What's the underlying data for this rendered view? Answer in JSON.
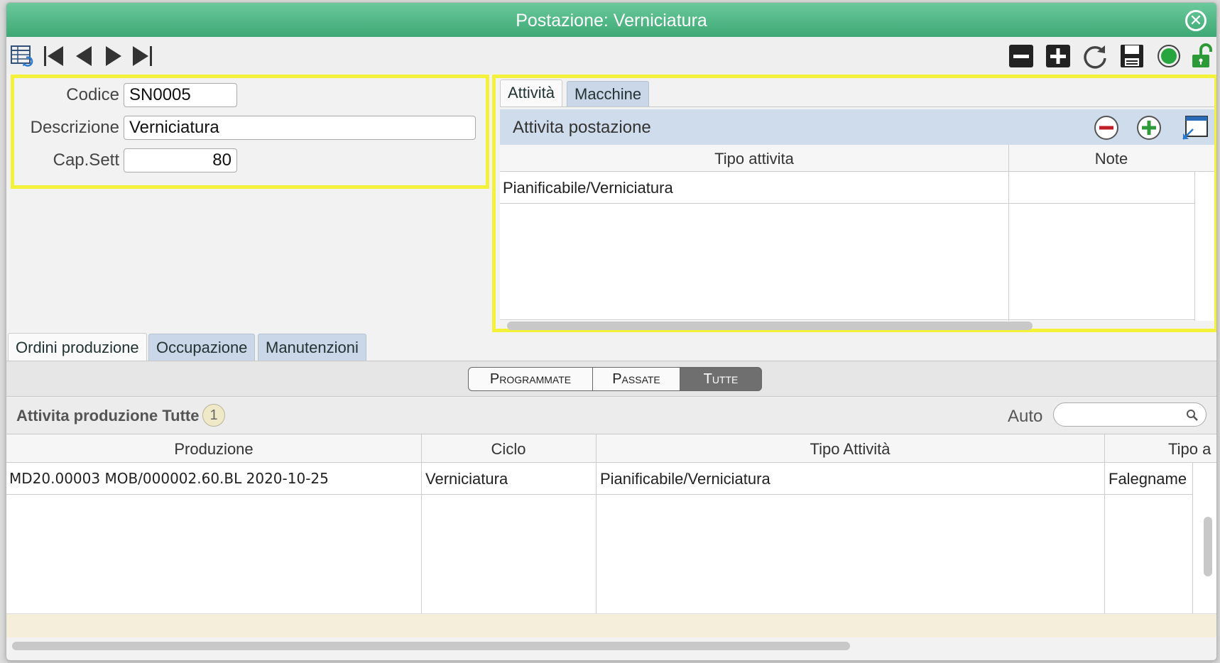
{
  "window": {
    "title": "Postazione: Verniciatura"
  },
  "toolbar": {
    "left_icons": [
      "grid-return-icon",
      "first-record-icon",
      "prev-record-icon",
      "next-record-icon",
      "last-record-icon"
    ],
    "right_icons": [
      "delete-record-icon",
      "add-record-icon",
      "refresh-icon",
      "save-icon",
      "status-green-icon",
      "unlock-icon"
    ]
  },
  "form": {
    "codice": {
      "label": "Codice",
      "value": "SN0005"
    },
    "descrizione": {
      "label": "Descrizione",
      "value": "Verniciatura"
    },
    "cap_sett": {
      "label": "Cap.Sett",
      "value": "80"
    }
  },
  "right_tabs": [
    {
      "label": "Attività",
      "active": true
    },
    {
      "label": "Macchine",
      "active": false
    }
  ],
  "activity_panel": {
    "title": "Attivita postazione",
    "columns": [
      "Tipo attivita",
      "Note"
    ],
    "rows": [
      {
        "tipo": "Pianificabile/Verniciatura",
        "note": ""
      }
    ]
  },
  "bottom_tabs": [
    {
      "label": "Ordini produzione",
      "active": true
    },
    {
      "label": "Occupazione",
      "active": false
    },
    {
      "label": "Manutenzioni",
      "active": false
    }
  ],
  "segments": [
    {
      "label": "Programmate",
      "active": false
    },
    {
      "label": "Passate",
      "active": false
    },
    {
      "label": "Tutte",
      "active": true
    }
  ],
  "production_panel": {
    "title": "Attivita produzione Tutte",
    "count": "1",
    "auto_label": "Auto",
    "search_value": "",
    "columns": [
      "Produzione",
      "Ciclo",
      "Tipo Attività",
      "Tipo a"
    ],
    "rows": [
      {
        "produzione": "MD20.00003 MOB/000002.60.BL 2020-10-25",
        "ciclo": "Verniciatura",
        "tipo_attivita": "Pianificabile/Verniciatura",
        "tipo_a": "Falegname"
      }
    ]
  },
  "colors": {
    "title_bar": "#4db884",
    "highlight": "#f4f13a",
    "tab_inactive": "#c9d7e8"
  }
}
